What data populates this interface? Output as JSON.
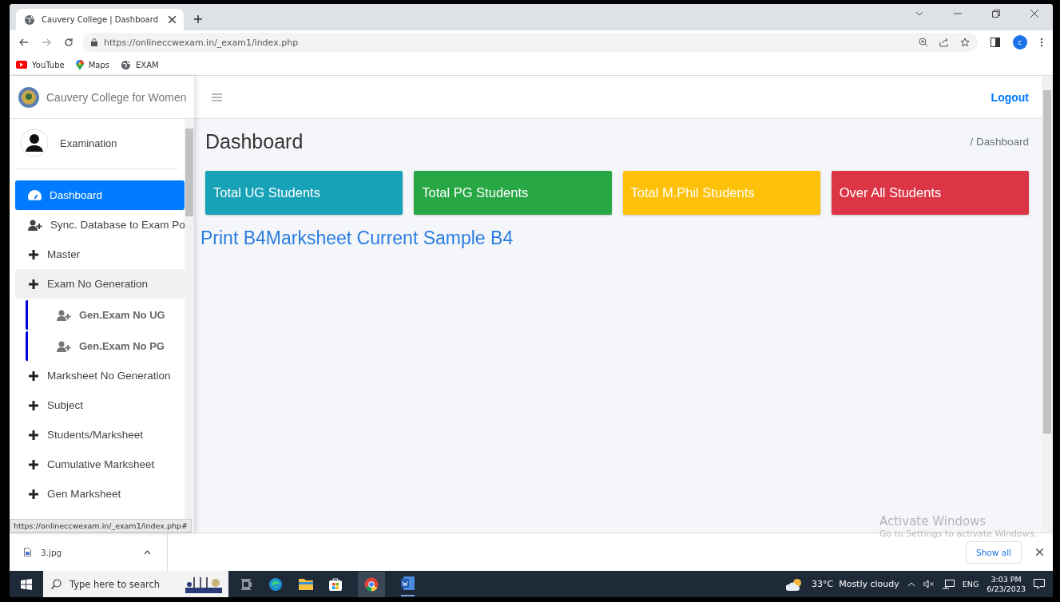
{
  "browser": {
    "tab_title": "Cauvery College | Dashboard",
    "url": "https://onlineccwexam.in/_exam1/index.php",
    "bookmarks": [
      {
        "kind": "youtube",
        "label": "YouTube"
      },
      {
        "kind": "maps",
        "label": "Maps"
      },
      {
        "kind": "globe",
        "label": "EXAM"
      }
    ],
    "profile_initial": "c"
  },
  "sidebar": {
    "brand": "Cauvery College for Women",
    "user": "Examination",
    "items": [
      {
        "kind": "dashboard",
        "label": "Dashboard",
        "selected": true,
        "expanded": false
      },
      {
        "kind": "user-plus",
        "label": "Sync. Database to Exam Po",
        "selected": false,
        "expanded": false
      },
      {
        "kind": "plus",
        "label": "Master",
        "selected": false,
        "expanded": false
      },
      {
        "kind": "plus",
        "label": "Exam No Generation",
        "selected": false,
        "expanded": true,
        "children": [
          {
            "kind": "user-plus",
            "label": "Gen.Exam No UG"
          },
          {
            "kind": "user-plus",
            "label": "Gen.Exam No PG"
          }
        ]
      },
      {
        "kind": "plus",
        "label": "Marksheet No Generation",
        "selected": false,
        "expanded": false
      },
      {
        "kind": "plus",
        "label": "Subject",
        "selected": false,
        "expanded": false
      },
      {
        "kind": "plus",
        "label": "Students/Marksheet",
        "selected": false,
        "expanded": false
      },
      {
        "kind": "plus",
        "label": "Cumulative Marksheet",
        "selected": false,
        "expanded": false
      },
      {
        "kind": "plus",
        "label": "Gen Marksheet",
        "selected": false,
        "expanded": false
      }
    ]
  },
  "main": {
    "logout": "Logout",
    "title": "Dashboard",
    "breadcrumb": "/ Dashboard",
    "cards": [
      {
        "label": "Total UG Students",
        "color": "#17a2b8"
      },
      {
        "label": "Total PG Students",
        "color": "#28a745"
      },
      {
        "label": "Total M.Phil Students",
        "color": "#ffc107"
      },
      {
        "label": "Over All Students",
        "color": "#dc3545"
      }
    ],
    "link": "Print B4Marksheet Current Sample B4"
  },
  "status_url": "https://onlineccwexam.in/_exam1/index.php#",
  "activation": {
    "title": "Activate Windows",
    "subtitle": "Go to Settings to activate Windows."
  },
  "downloads": {
    "file": "3.jpg",
    "show_all": "Show all"
  },
  "taskbar": {
    "search_placeholder": "Type here to search",
    "weather": "33°C  Mostly cloudy",
    "language": "ENG",
    "time": "3:03 PM",
    "date": "6/23/2023"
  }
}
